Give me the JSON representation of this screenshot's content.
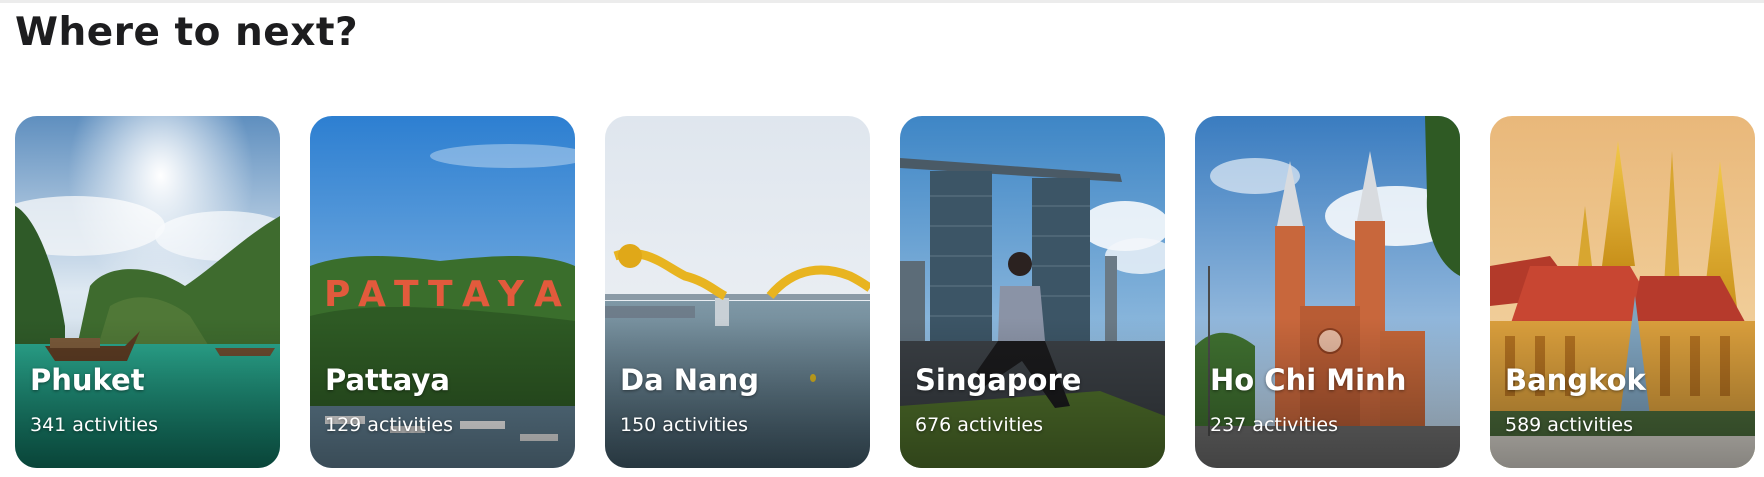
{
  "section": {
    "title": "Where to next?"
  },
  "destinations": [
    {
      "name": "Phuket",
      "activities": "341 activities",
      "image": "tropical-bay-longtail-boats"
    },
    {
      "name": "Pattaya",
      "activities": "129 activities",
      "image": "pattaya-hillside-sign-harbor"
    },
    {
      "name": "Da Nang",
      "activities": "150 activities",
      "image": "dragon-bridge-river"
    },
    {
      "name": "Singapore",
      "activities": "676 activities",
      "image": "marina-bay-sands-woman-stretching"
    },
    {
      "name": "Ho Chi Minh",
      "activities": "237 activities",
      "image": "saigon-notre-dame-cathedral"
    },
    {
      "name": "Bangkok",
      "activities": "589 activities",
      "image": "grand-palace-temple"
    }
  ]
}
